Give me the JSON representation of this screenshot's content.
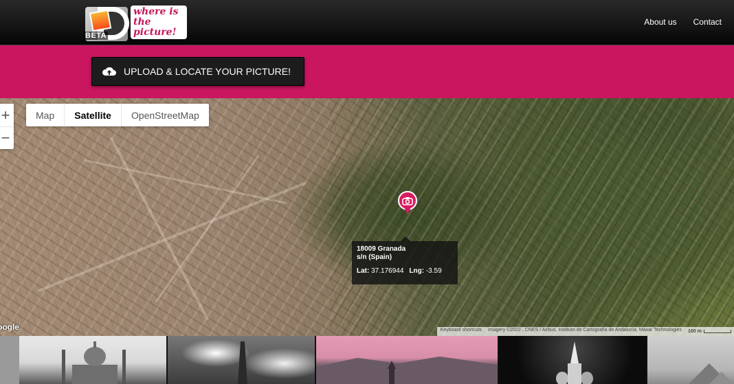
{
  "header": {
    "logo_text": "where is the picture!",
    "logo_badge": "BETA",
    "nav": [
      "About us",
      "Contact"
    ]
  },
  "upload": {
    "label": "UPLOAD & LOCATE YOUR PICTURE!",
    "icon": "cloud-upload-icon"
  },
  "map": {
    "zoom_in": "+",
    "zoom_out": "−",
    "types": [
      "Map",
      "Satellite",
      "OpenStreetMap"
    ],
    "active_type": "Satellite",
    "marker_icon": "camera-icon",
    "info": {
      "line1": "18009 Granada",
      "line2": "s/n (Spain)",
      "lat_label": "Lat:",
      "lat_value": "37.176944",
      "lng_label": "Lng:",
      "lng_value": "-3.59"
    },
    "google_label": "oogle",
    "attribution": {
      "shortcuts": "Keyboard shortcuts",
      "imagery": "Imagery ©2022 , CNES / Airbus, Instituto de Cartografía de Andalucía, Maxar Technologies",
      "scale": "100 m"
    }
  },
  "gallery": [
    "Taj Mahal",
    "Eiffel Tower",
    "Mountain town",
    "Moscow cathedral",
    "Pyramids"
  ],
  "colors": {
    "accent": "#c9165f",
    "header_bg": "#111111",
    "marker": "#d81b60"
  }
}
